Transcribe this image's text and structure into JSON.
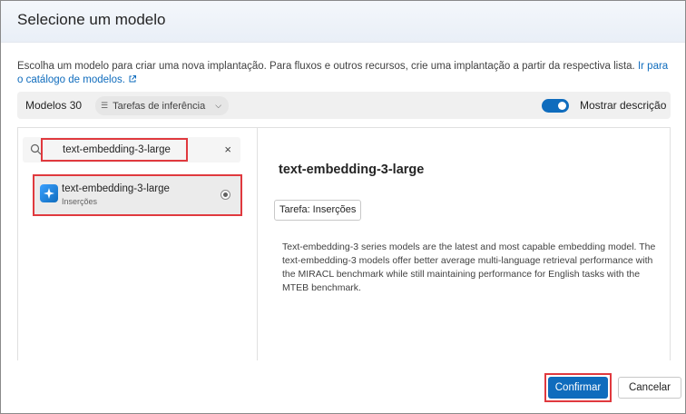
{
  "dialog": {
    "title": "Selecione um modelo",
    "description": "Escolha um modelo para criar uma nova implantação. Para fluxos e outros recursos, crie uma implantação a partir da respectiva lista.",
    "catalog_link": "Ir para o catálogo de modelos."
  },
  "toolbar": {
    "models_count": "Modelos 30",
    "filter_label": "Tarefas de inferência",
    "filter_icon": "list-icon",
    "toggle_label": "Mostrar descrição",
    "toggle_on": true,
    "accent_color": "#0f6cbd"
  },
  "search": {
    "value": "text-embedding-3-large"
  },
  "model_list": [
    {
      "name": "text-embedding-3-large",
      "task": "Inserções",
      "selected": true
    }
  ],
  "detail": {
    "title": "text-embedding-3-large",
    "task_badge": "Tarefa: Inserções",
    "description": "Text-embedding-3 series models are the latest and most capable embedding model. The text-embedding-3 models offer better average multi-language retrieval performance with the MIRACL benchmark while still maintaining performance for English tasks with the MTEB benchmark."
  },
  "footer": {
    "confirm_label": "Confirmar",
    "cancel_label": "Cancelar"
  },
  "highlight_color": "#e0393e"
}
